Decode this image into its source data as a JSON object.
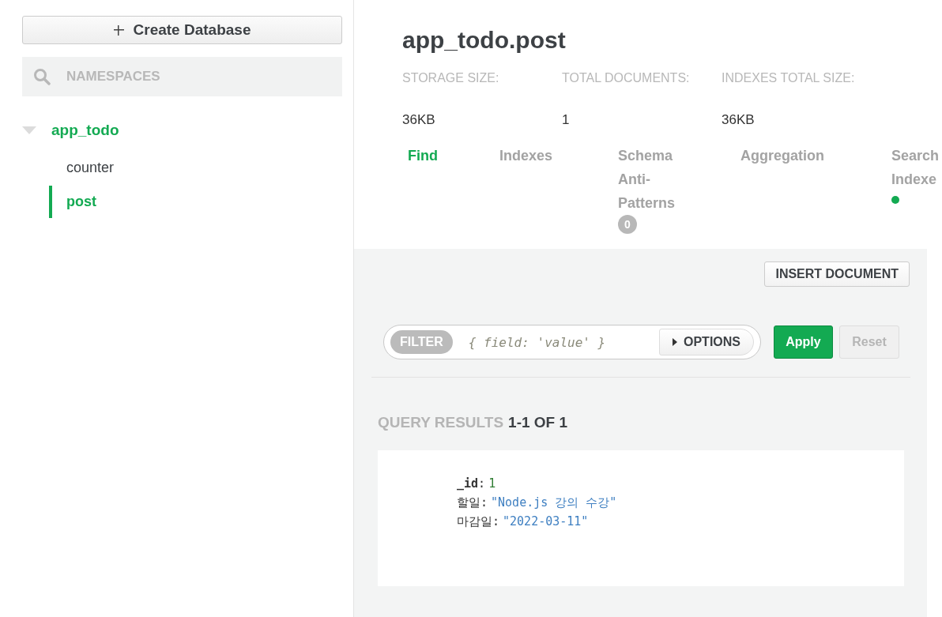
{
  "sidebar": {
    "create_button": "Create Database",
    "search": {
      "placeholder": "NAMESPACES"
    },
    "databases": [
      {
        "name": "app_todo",
        "expanded": true,
        "children": [
          {
            "name": "counter",
            "selected": false
          },
          {
            "name": "post",
            "selected": true
          }
        ]
      }
    ]
  },
  "collection": {
    "title": "app_todo.post",
    "stats": [
      {
        "label": "STORAGE SIZE:",
        "value": "36KB"
      },
      {
        "label": "TOTAL DOCUMENTS:",
        "value": "1"
      },
      {
        "label": "INDEXES TOTAL SIZE:",
        "value": "36KB"
      }
    ]
  },
  "tabs": [
    {
      "label": "Find",
      "selected": true,
      "kind": "plain"
    },
    {
      "label": "Indexes",
      "selected": false,
      "kind": "plain"
    },
    {
      "label": "Schema Anti-Patterns",
      "selected": false,
      "kind": "badge",
      "badge": "0"
    },
    {
      "label": "Aggregation",
      "selected": false,
      "kind": "plain"
    },
    {
      "label": "Search Indexe",
      "selected": false,
      "kind": "dot",
      "color": "#13aa52"
    }
  ],
  "insert_button": "INSERT DOCUMENT",
  "filter": {
    "tag": "FILTER",
    "placeholder": "{ field: 'value' }",
    "options": "OPTIONS",
    "apply": "Apply",
    "reset": "Reset",
    "reset_disabled": true
  },
  "results": {
    "label": "QUERY RESULTS",
    "range": "1-1 OF 1"
  },
  "documents": [
    {
      "fields": [
        {
          "key": "_id",
          "separator": ":",
          "value": "1",
          "kind": "number"
        },
        {
          "key": "할일",
          "separator": ":",
          "value": "\"Node.js 강의 수강\"",
          "kind": "string"
        },
        {
          "key": "마감일",
          "separator": ":",
          "value": "\"2022-03-11\"",
          "kind": "string"
        }
      ]
    }
  ]
}
